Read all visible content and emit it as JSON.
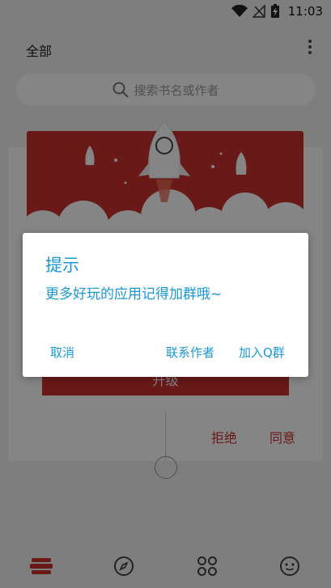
{
  "status_bar": {
    "time": "11:03"
  },
  "header": {
    "title": "全部"
  },
  "search": {
    "placeholder": "搜索书名或作者"
  },
  "update_card": {
    "upgrade_label": "升级",
    "refuse_label": "拒绝",
    "agree_label": "同意"
  },
  "dialog": {
    "title": "提示",
    "message": "更多好玩的应用记得加群哦~",
    "cancel_label": "取消",
    "contact_label": "联系作者",
    "join_label": "加入Q群"
  },
  "bottom_nav": {
    "items": [
      {
        "icon": "bookshelf-icon",
        "active": true
      },
      {
        "icon": "compass-icon",
        "active": false
      },
      {
        "icon": "apps-grid-icon",
        "active": false
      },
      {
        "icon": "smiley-icon",
        "active": false
      }
    ]
  },
  "colors": {
    "accent": "#1a98d5",
    "brand_red": "#c9302c",
    "scrim": "rgba(0,0,0,0.48)"
  }
}
